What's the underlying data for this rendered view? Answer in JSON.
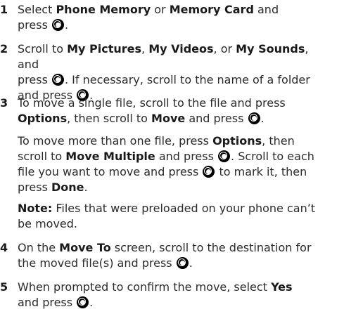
{
  "steps": [
    {
      "number": "1",
      "t1": "Select ",
      "b1": "Phone Memory",
      "t2": " or ",
      "b2": "Memory Card",
      "t3": " and",
      "t4": "press ",
      "t5": "."
    },
    {
      "number": "2",
      "t1": "Scroll to ",
      "b1": "My Pictures",
      "t2": ", ",
      "b2": "My Videos",
      "t3": ", or ",
      "b3": "My Sounds",
      "t4": ", and",
      "t5": "press ",
      "t6": ". If necessary, scroll to the name of a folder",
      "t7": "and press ",
      "t8": "."
    },
    {
      "number": "3",
      "t1": "To move a single file, scroll to the file and press",
      "b1": "Options",
      "t2": ", then scroll to ",
      "b2": "Move",
      "t3": " and press ",
      "t4": "."
    },
    {
      "p1": "To move more than one file, press ",
      "b1": "Options",
      "t1": ", then",
      "t2": "scroll to ",
      "b2": "Move Multiple",
      "t3": " and press ",
      "t4": ". Scroll to each",
      "t5": "file you want to move and press ",
      "t6": " to mark it, then",
      "t7": "press ",
      "b3": "Done",
      "t8": "."
    },
    {
      "b1": "Note:",
      "t1": " Files that were preloaded on your phone can’t",
      "t2": "be moved."
    },
    {
      "number": "4",
      "t1": "On the ",
      "b1": "Move To",
      "t2": " screen, scroll to the destination for",
      "t3": "the moved file(s) and press ",
      "t4": "."
    },
    {
      "number": "5",
      "t1": "When prompted to confirm the move, select ",
      "b1": "Yes",
      "t2": "and press ",
      "t3": "."
    }
  ]
}
